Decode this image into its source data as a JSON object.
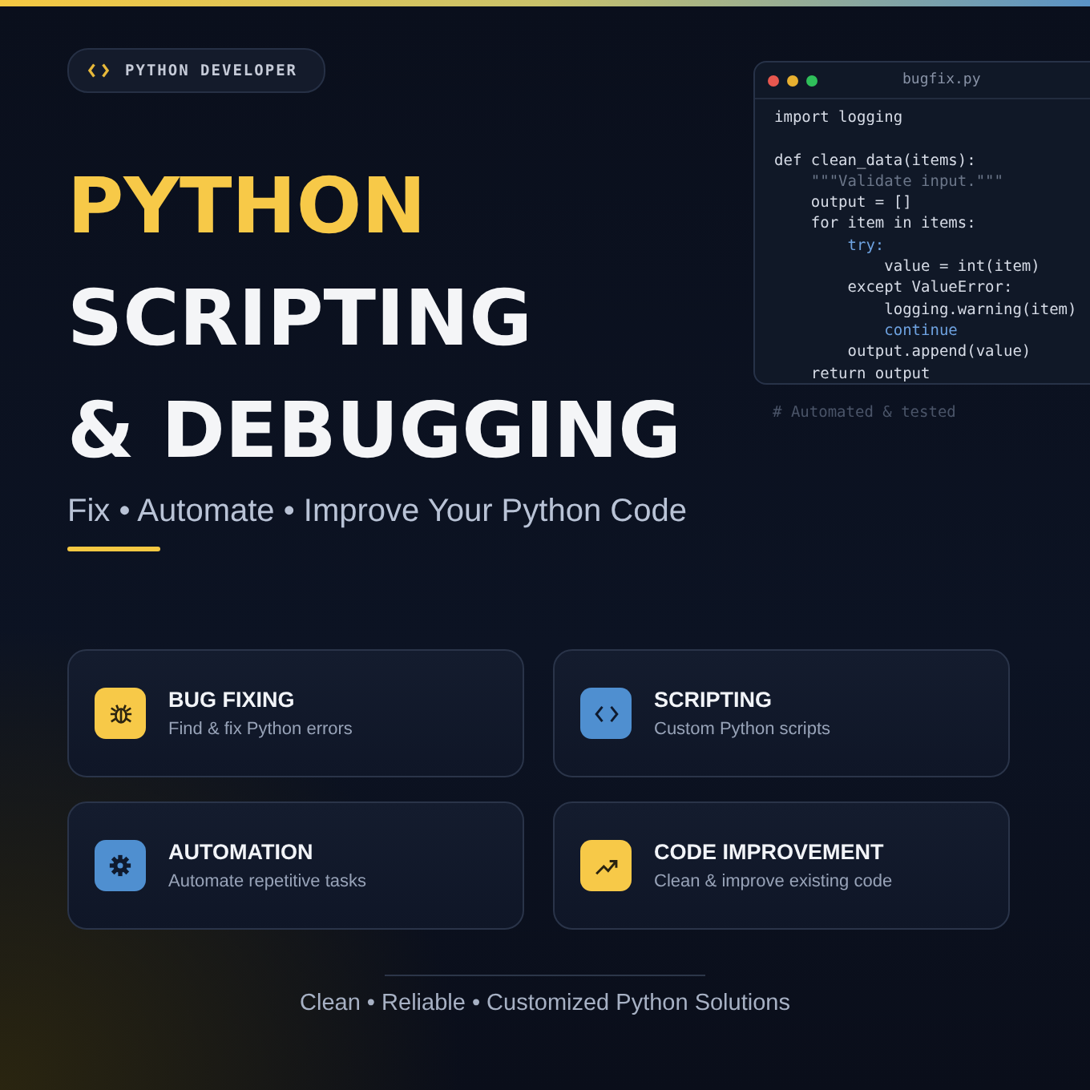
{
  "badge": {
    "label": "PYTHON DEVELOPER"
  },
  "title": {
    "lines": [
      {
        "text": "PYTHON",
        "highlight": true
      },
      {
        "text": "SCRIPTING",
        "highlight": false
      },
      {
        "text": "& DEBUGGING",
        "highlight": false
      }
    ]
  },
  "subtitle": "Fix • Automate • Improve Your Python Code",
  "code_window": {
    "filename": "bugfix.py",
    "lines": [
      {
        "text": "import logging",
        "kind": "code"
      },
      {
        "kind": "blank"
      },
      {
        "text": "def clean_data(items):",
        "kind": "code"
      },
      {
        "text": "    \"\"\"Validate input.\"\"\"",
        "kind": "doc"
      },
      {
        "text": "    output = []",
        "kind": "code"
      },
      {
        "text": "    for item in items:",
        "kind": "code"
      },
      {
        "text": "        try:",
        "kind": "keyword"
      },
      {
        "text": "            value = int(item)",
        "kind": "code"
      },
      {
        "text": "        except ValueError:",
        "kind": "code"
      },
      {
        "text": "            logging.warning(item)",
        "kind": "code"
      },
      {
        "text": "            continue",
        "kind": "keyword"
      },
      {
        "text": "        output.append(value)",
        "kind": "code"
      },
      {
        "text": "    return output",
        "kind": "code"
      }
    ],
    "comment": "# Automated & tested"
  },
  "features": [
    {
      "title": "BUG FIXING",
      "description": "Find & fix Python errors",
      "kind": "bug",
      "color": "#f7c948"
    },
    {
      "title": "SCRIPTING",
      "description": "Custom Python scripts",
      "kind": "code",
      "color": "#4f8fd0"
    },
    {
      "title": "AUTOMATION",
      "description": "Automate repetitive tasks",
      "kind": "gear",
      "color": "#4f8fd0"
    },
    {
      "title": "CODE IMPROVEMENT",
      "description": "Clean & improve existing code",
      "kind": "trend",
      "color": "#f7c948"
    }
  ],
  "footer": "Clean • Reliable • Customized Python Solutions"
}
